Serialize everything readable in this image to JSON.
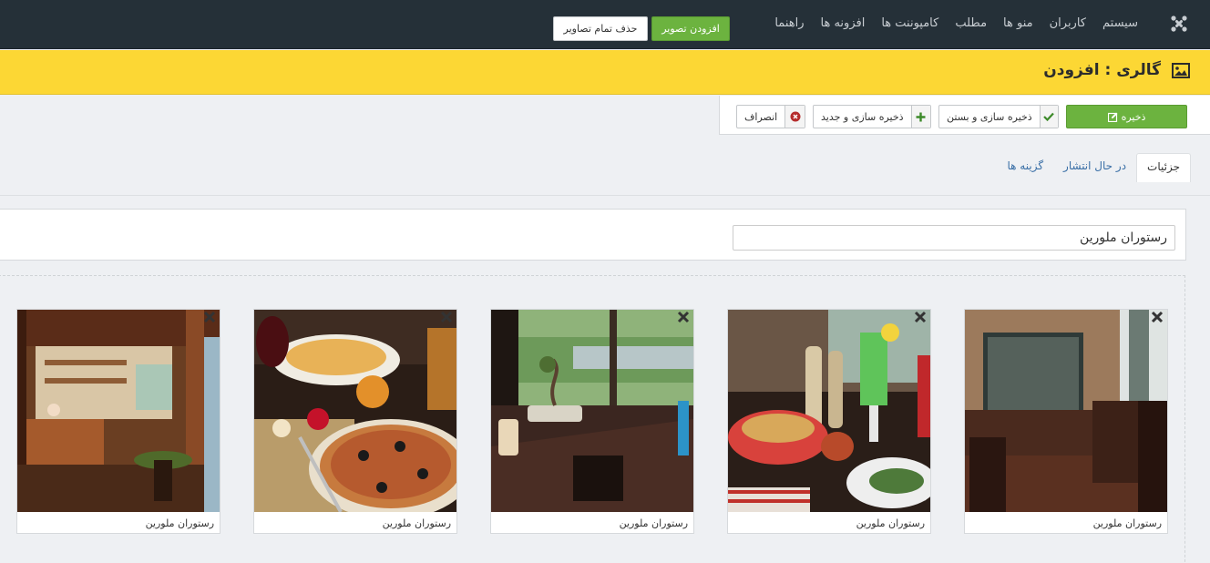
{
  "nav": {
    "items": [
      "سیستم",
      "کاربران",
      "منو ها",
      "مطلب",
      "کامپوننت ها",
      "افزونه ها",
      "راهنما"
    ]
  },
  "header": {
    "title": "گالری : افزودن"
  },
  "toolbar": {
    "save_label": "ذخیره",
    "save_close_label": "ذخیره سازی و بستن",
    "save_new_label": "ذخیره سازی و جدید",
    "cancel_label": "انصراف"
  },
  "tabs": [
    {
      "label": "جزئیات",
      "active": true
    },
    {
      "label": "در حال انتشار",
      "active": false
    },
    {
      "label": "گزینه ها",
      "active": false
    }
  ],
  "form": {
    "name_value": "رستوران ملورین",
    "add_image_label": "افزودن تصویر",
    "delete_all_label": "حذف تمام تصاویر"
  },
  "gallery": {
    "images": [
      {
        "caption": "رستوران ملورین",
        "scene": "dining-room"
      },
      {
        "caption": "رستوران ملورین",
        "scene": "table-with-drinks"
      },
      {
        "caption": "رستوران ملورین",
        "scene": "window-table"
      },
      {
        "caption": "رستوران ملورین",
        "scene": "pizza"
      },
      {
        "caption": "رستوران ملورین",
        "scene": "bar-interior"
      }
    ]
  },
  "colors": {
    "navbar": "#253038",
    "title_bar": "#fcd734",
    "success": "#6cb33f",
    "link": "#3a6fa6"
  }
}
